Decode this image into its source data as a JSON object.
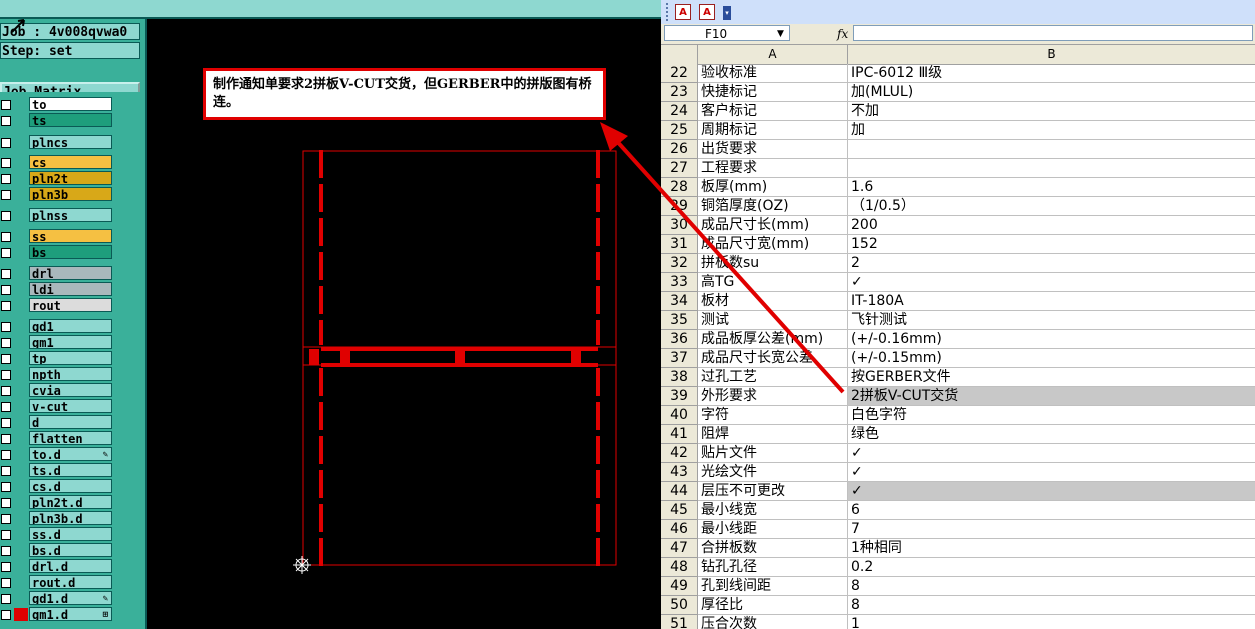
{
  "cam": {
    "job_line": "Job : 4v008qvwa0",
    "step_line": "Step: set",
    "matrix_button": "Job Matrix ...",
    "layers": [
      {
        "name": "to",
        "color": "#ffffff",
        "mark": ""
      },
      {
        "name": "ts",
        "color": "#1e9e7c",
        "mark": ""
      },
      {
        "name": "plncs",
        "color": "#8ed8d0",
        "mark": ""
      },
      {
        "name": "cs",
        "color": "#f5c042",
        "mark": ""
      },
      {
        "name": "pln2t",
        "color": "#d8a818",
        "mark": ""
      },
      {
        "name": "pln3b",
        "color": "#d8a818",
        "mark": ""
      },
      {
        "name": "plnss",
        "color": "#8ed8d0",
        "mark": ""
      },
      {
        "name": "ss",
        "color": "#f5c042",
        "mark": ""
      },
      {
        "name": "bs",
        "color": "#1e9e7c",
        "mark": ""
      },
      {
        "name": "drl",
        "color": "#a9b8bc",
        "mark": ""
      },
      {
        "name": "ldi",
        "color": "#a9b8bc",
        "mark": ""
      },
      {
        "name": "rout",
        "color": "#dcdcdc",
        "mark": ""
      },
      {
        "name": "gd1",
        "color": "#8ed8d0",
        "mark": ""
      },
      {
        "name": "gm1",
        "color": "#8ed8d0",
        "mark": ""
      },
      {
        "name": "tp",
        "color": "#8ed8d0",
        "mark": ""
      },
      {
        "name": "npth",
        "color": "#8ed8d0",
        "mark": ""
      },
      {
        "name": "cvia",
        "color": "#8ed8d0",
        "mark": ""
      },
      {
        "name": "v-cut",
        "color": "#8ed8d0",
        "mark": ""
      },
      {
        "name": "d",
        "color": "#8ed8d0",
        "mark": ""
      },
      {
        "name": "flatten",
        "color": "#8ed8d0",
        "mark": ""
      },
      {
        "name": "to.d",
        "color": "#8ed8d0",
        "mark": "✎"
      },
      {
        "name": "ts.d",
        "color": "#8ed8d0",
        "mark": ""
      },
      {
        "name": "cs.d",
        "color": "#8ed8d0",
        "mark": ""
      },
      {
        "name": "pln2t.d",
        "color": "#8ed8d0",
        "mark": ""
      },
      {
        "name": "pln3b.d",
        "color": "#8ed8d0",
        "mark": ""
      },
      {
        "name": "ss.d",
        "color": "#8ed8d0",
        "mark": ""
      },
      {
        "name": "bs.d",
        "color": "#8ed8d0",
        "mark": ""
      },
      {
        "name": "drl.d",
        "color": "#8ed8d0",
        "mark": ""
      },
      {
        "name": "rout.d",
        "color": "#8ed8d0",
        "mark": ""
      },
      {
        "name": "gd1.d",
        "color": "#8ed8d0",
        "mark": "✎"
      },
      {
        "name": "gm1.d",
        "color": "#8ed8d0",
        "mark": "⊞"
      }
    ],
    "annotation": "制作通知单要求2拼板V-CUT交货，但GERBER中的拼版图有桥连。"
  },
  "excel": {
    "name_box": "F10",
    "fx_label": "fx",
    "col_a": "A",
    "col_b": "B",
    "rows": [
      {
        "n": "22",
        "a": "验收标准",
        "b": "IPC-6012 Ⅲ级",
        "hl": false
      },
      {
        "n": "23",
        "a": "快捷标记",
        "b": "加(MLUL)",
        "hl": false
      },
      {
        "n": "24",
        "a": "客户标记",
        "b": "不加",
        "hl": false
      },
      {
        "n": "25",
        "a": "周期标记",
        "b": "加",
        "hl": false
      },
      {
        "n": "26",
        "a": "出货要求",
        "b": "",
        "hl": false
      },
      {
        "n": "27",
        "a": "工程要求",
        "b": "",
        "hl": false
      },
      {
        "n": "28",
        "a": "板厚(mm)",
        "b": "1.6",
        "hl": false
      },
      {
        "n": "29",
        "a": "铜箔厚度(OZ)",
        "b": "（1/0.5）",
        "hl": false
      },
      {
        "n": "30",
        "a": "成品尺寸长(mm)",
        "b": "200",
        "hl": false
      },
      {
        "n": "31",
        "a": "成品尺寸宽(mm)",
        "b": "152",
        "hl": false
      },
      {
        "n": "32",
        "a": "拼板数su",
        "b": "2",
        "hl": false
      },
      {
        "n": "33",
        "a": "高TG",
        "b": "✓",
        "hl": false
      },
      {
        "n": "34",
        "a": "板材",
        "b": "IT-180A",
        "hl": false
      },
      {
        "n": "35",
        "a": "测试",
        "b": "飞针测试",
        "hl": false
      },
      {
        "n": "36",
        "a": "成品板厚公差(mm)",
        "b": "(+/-0.16mm)",
        "hl": false
      },
      {
        "n": "37",
        "a": "成品尺寸长宽公差",
        "b": "(+/-0.15mm)",
        "hl": false
      },
      {
        "n": "38",
        "a": "过孔工艺",
        "b": "按GERBER文件",
        "hl": false
      },
      {
        "n": "39",
        "a": "外形要求",
        "b": "2拼板V-CUT交货",
        "hl": true
      },
      {
        "n": "40",
        "a": "字符",
        "b": "白色字符",
        "hl": false
      },
      {
        "n": "41",
        "a": "阻焊",
        "b": "绿色",
        "hl": false
      },
      {
        "n": "42",
        "a": "贴片文件",
        "b": "✓",
        "hl": false
      },
      {
        "n": "43",
        "a": "光绘文件",
        "b": "✓",
        "hl": false
      },
      {
        "n": "44",
        "a": "层压不可更改",
        "b": "✓",
        "hl": true
      },
      {
        "n": "45",
        "a": "最小线宽",
        "b": "6",
        "hl": false
      },
      {
        "n": "46",
        "a": "最小线距",
        "b": "7",
        "hl": false
      },
      {
        "n": "47",
        "a": "合拼板数",
        "b": "1种相同",
        "hl": false
      },
      {
        "n": "48",
        "a": "钻孔孔径",
        "b": "0.2",
        "hl": false
      },
      {
        "n": "49",
        "a": "孔到线间距",
        "b": "8",
        "hl": false
      },
      {
        "n": "50",
        "a": "厚径比",
        "b": "8",
        "hl": false
      },
      {
        "n": "51",
        "a": "压合次数",
        "b": "1",
        "hl": false
      }
    ]
  },
  "colors": {
    "accent_red": "#e00000",
    "cam_panel": "#8ed8d0"
  }
}
